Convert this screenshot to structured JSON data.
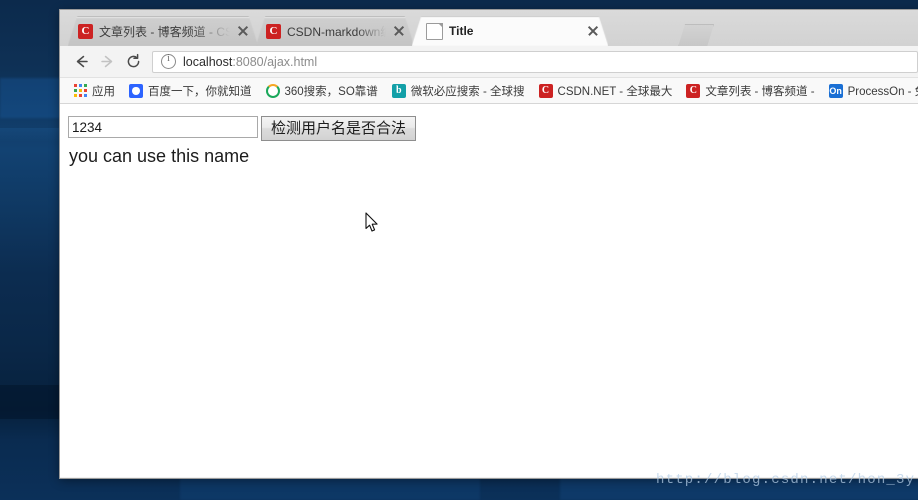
{
  "desktop": {
    "watermark": "http://blog.csdn.net/hon_3y",
    "background_color": "#0b2b50"
  },
  "browser": {
    "tabs": [
      {
        "title": "文章列表 - 博客频道 - CS",
        "favicon": "csdn-favicon",
        "favicon_letter": "C",
        "active": false,
        "close_label": "×"
      },
      {
        "title": "CSDN-markdown编辑器",
        "favicon": "csdn-favicon",
        "favicon_letter": "C",
        "active": false,
        "close_label": "×"
      },
      {
        "title": "Title",
        "favicon": "document-favicon",
        "favicon_letter": "",
        "active": true,
        "close_label": "×"
      }
    ],
    "new_tab_name": "new-tab-button",
    "toolbar": {
      "back_icon": "arrow-left-icon",
      "forward_icon": "arrow-right-icon",
      "reload_icon": "reload-icon",
      "security_icon": "info-circle-icon",
      "url_host": "localhost",
      "url_path": ":8080/ajax.html",
      "url_full": "localhost:8080/ajax.html"
    },
    "bookmarks": [
      {
        "label": "应用",
        "icon": "apps-grid-icon",
        "icon_letter": ""
      },
      {
        "label": "百度一下，你就知道",
        "icon": "baidu-icon",
        "icon_letter": ""
      },
      {
        "label": "360搜索，SO靠谱",
        "icon": "so360-icon",
        "icon_letter": ""
      },
      {
        "label": "微软必应搜索 - 全球搜",
        "icon": "bing-icon",
        "icon_letter": "b"
      },
      {
        "label": "CSDN.NET - 全球最大",
        "icon": "csdn-icon",
        "icon_letter": "C"
      },
      {
        "label": "文章列表 - 博客频道 -",
        "icon": "csdn-icon",
        "icon_letter": "C"
      },
      {
        "label": "ProcessOn - 免费在线",
        "icon": "processon-icon",
        "icon_letter": "On"
      }
    ]
  },
  "page": {
    "username_value": "1234",
    "username_placeholder": "",
    "check_button_label": "检测用户名是否合法",
    "result_message": "you can use this name"
  }
}
